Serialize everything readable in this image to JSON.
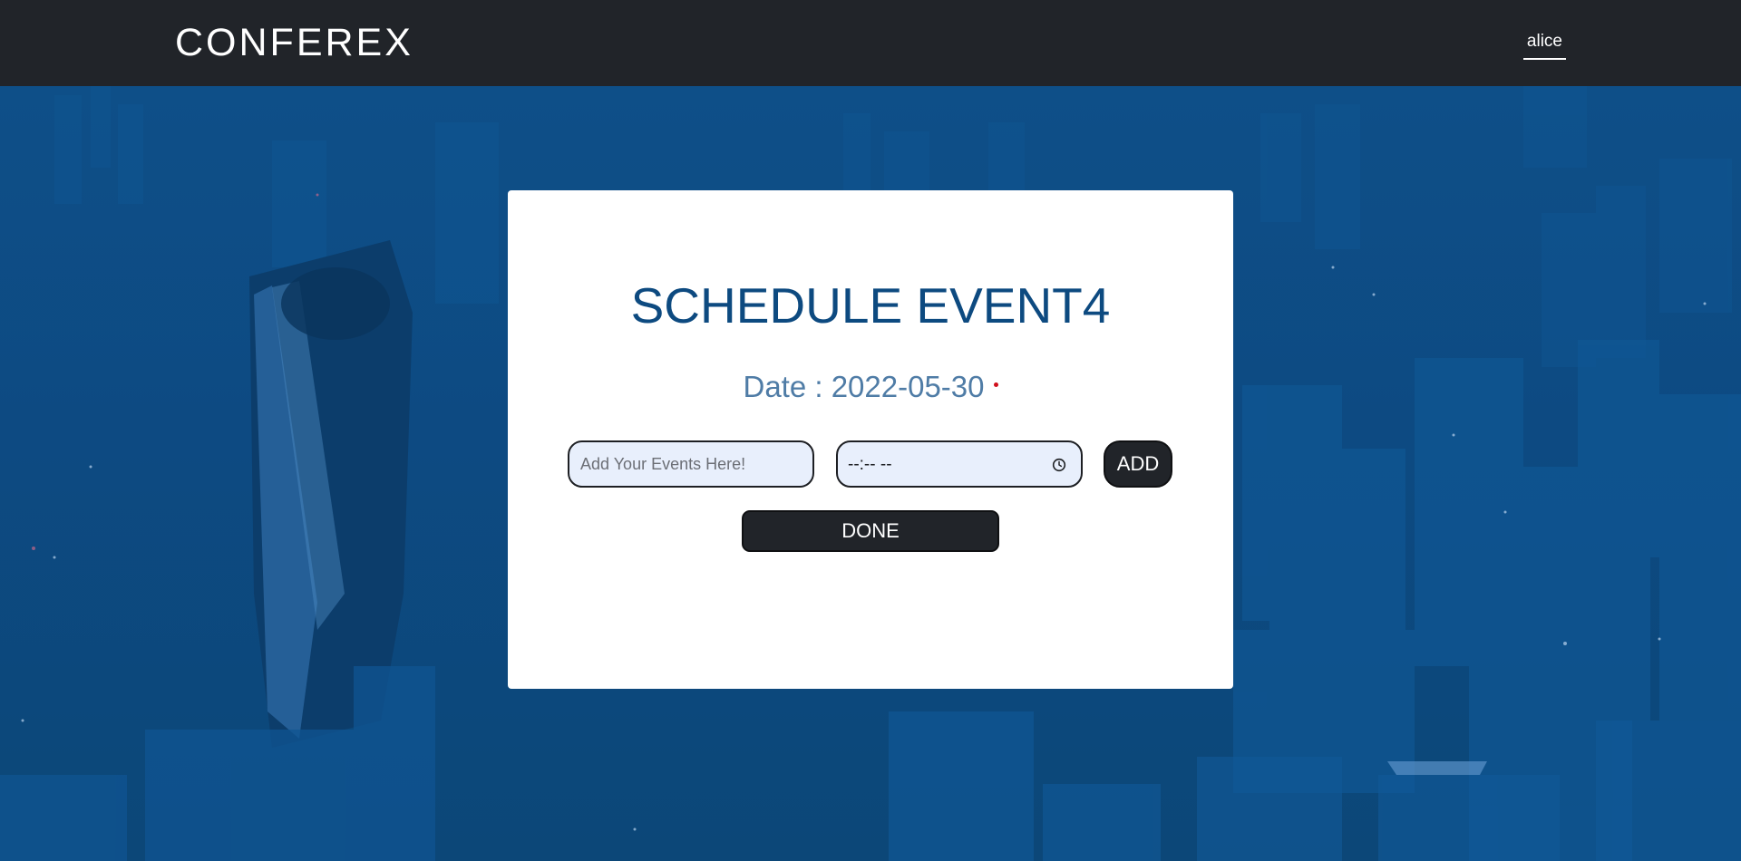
{
  "navbar": {
    "brand": "CONFEREX",
    "user": "alice"
  },
  "card": {
    "title": "SCHEDULE EVENT4",
    "date_label": "Date : 2022-05-30",
    "event_input": {
      "value": "",
      "placeholder": "Add Your Events Here!"
    },
    "time_input": {
      "value": "--:-- --",
      "icon": "clock-icon"
    },
    "add_label": "ADD",
    "done_label": "DONE"
  },
  "colors": {
    "navbar_bg": "#212429",
    "page_bg": "#0d4a80",
    "title": "#0d4a80",
    "date_text": "#4f7ca6",
    "input_bg": "#e8effc",
    "button_bg": "#212429",
    "required_dot": "#d0101c"
  }
}
